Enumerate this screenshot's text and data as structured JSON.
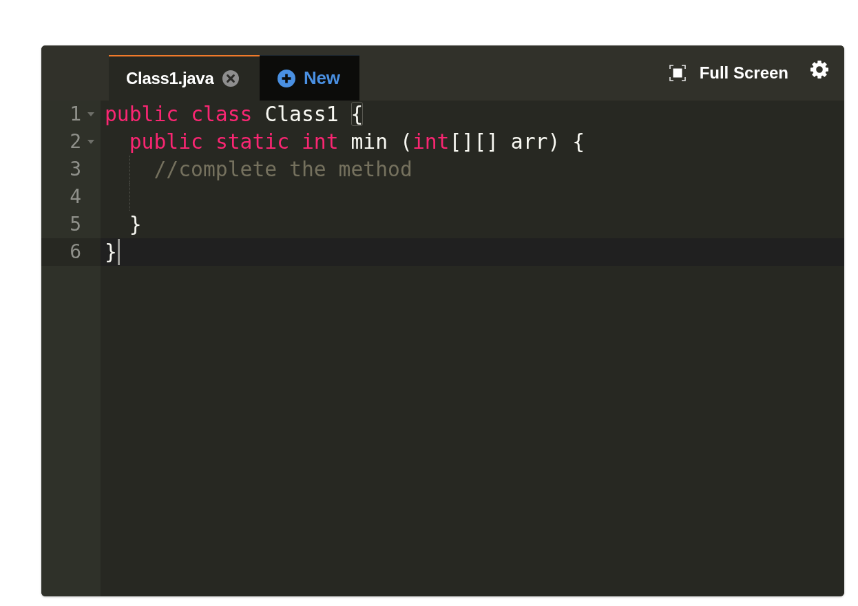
{
  "tabs": [
    {
      "kind": "file",
      "label": "Class1.java",
      "selected": true
    },
    {
      "kind": "new",
      "label": "New",
      "selected": false
    }
  ],
  "toolbar": {
    "full_screen_label": "Full Screen"
  },
  "editor": {
    "lines": [
      {
        "number": "1",
        "foldable": true,
        "indent_guide": false,
        "active": false,
        "tokens": [
          {
            "kind": "keyword",
            "text": "public "
          },
          {
            "kind": "keyword",
            "text": "class "
          },
          {
            "kind": "plain",
            "text": "Class1 "
          },
          {
            "kind": "bracket_match",
            "text": "{"
          }
        ]
      },
      {
        "number": "2",
        "foldable": true,
        "indent_guide": false,
        "active": false,
        "tokens": [
          {
            "kind": "keyword",
            "text": "  public "
          },
          {
            "kind": "keyword",
            "text": "static "
          },
          {
            "kind": "keyword",
            "text": "int "
          },
          {
            "kind": "plain",
            "text": "min ("
          },
          {
            "kind": "keyword",
            "text": "int"
          },
          {
            "kind": "plain",
            "text": "[][] arr) {"
          }
        ]
      },
      {
        "number": "3",
        "foldable": false,
        "indent_guide": true,
        "active": false,
        "tokens": [
          {
            "kind": "comment",
            "text": "    //complete the method"
          }
        ]
      },
      {
        "number": "4",
        "foldable": false,
        "indent_guide": true,
        "active": false
      },
      {
        "number": "5",
        "foldable": false,
        "indent_guide": false,
        "active": false,
        "tokens": [
          {
            "kind": "plain",
            "text": "  }"
          }
        ]
      },
      {
        "number": "6",
        "foldable": false,
        "indent_guide": false,
        "active": true,
        "tokens": [
          {
            "kind": "plain",
            "text": "}"
          }
        ]
      }
    ]
  }
}
